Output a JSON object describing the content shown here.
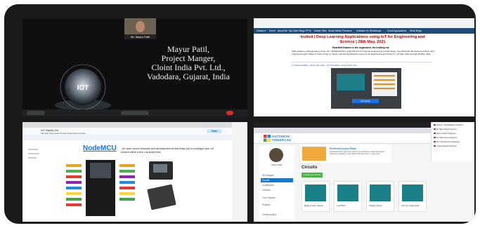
{
  "video_call": {
    "presenter_name": "Mr. Mayur Patil",
    "slide_lines": [
      "Mayur Patil,",
      "Project Manger,",
      "Cloint India Pvt. Ltd.,",
      "Vadodara, Gujarat, India"
    ],
    "orb_label": "IOT"
  },
  "invite_doc": {
    "nav_items": [
      "Classic ▾",
      "Home",
      "About Me",
      "My Other Blogs",
      "PPTs",
      "Mobile Tabs",
      "Social Media Presence",
      "Invitation for Workshops",
      "Cloud Applications",
      "Word Blogs"
    ],
    "title": "Invited | Deep Learning Applications using IoT for Engineering and Science | 28th May, 2021",
    "thanks": "Heartfelt thanks to the organizers for inviting me",
    "body": "SKN Academy of Engineering, Pune, AC, I.B.Maharashtra, India School of Computer Engineering & Technology. One Week AICTE Sponsored Short Term Training Program Phase II online mode on \"Deep Learning Applications using IoT for Engineering and Science\" | 24 May, 2021 through 28 May, 2021.",
    "link_text": "1) Tinkercad Blink, check and make - IoT Simulation using Tinker Cad",
    "sim_button": "Simulation"
  },
  "nodemcu_doc": {
    "doc_name": "IoT Hands-On",
    "menus": "File  Edit  View  Insert  Format  Tools  Add-ons  Help",
    "share_label": "Share",
    "heading": "NodeMCU",
    "subtitle": "- An open source firmware and development kit that helps you to prototype your IoT product within a few Lua script lines"
  },
  "tinkercad": {
    "brand_line1": "AUTODESK",
    "brand_line2": "TINKERCAD",
    "user_name": "Mayur Patil",
    "sidebar_items": [
      "3D Designs",
      "Circuits",
      "Codeblocks",
      "Lessons",
      "Your Classes",
      "Projects",
      "Create project"
    ],
    "banner_title": "Preferred Lesson Plans",
    "banner_text": "Preferred lesson plans are ready to use without to ready instructions classroom-activities to get started with electronics. Learn more",
    "section_title": "Circuits",
    "new_button": "Create new Circuit",
    "cards": [
      "Mighty Luluko-Jasson",
      "Cool Blinit",
      "Swanky Sango",
      "Glorious Gage-Gaiel"
    ],
    "participants": [
      "Abhinav - AlahiAddBank (Organizer)",
      "Mr. Mayur Patil (Presenter)",
      "Sachin Kedari (Organizer)",
      "Dr. Neha Gupta (Organizer)",
      "Prof. Shubha Kane (Organizer)",
      "Yogesh Gawad (Organizer)"
    ]
  }
}
